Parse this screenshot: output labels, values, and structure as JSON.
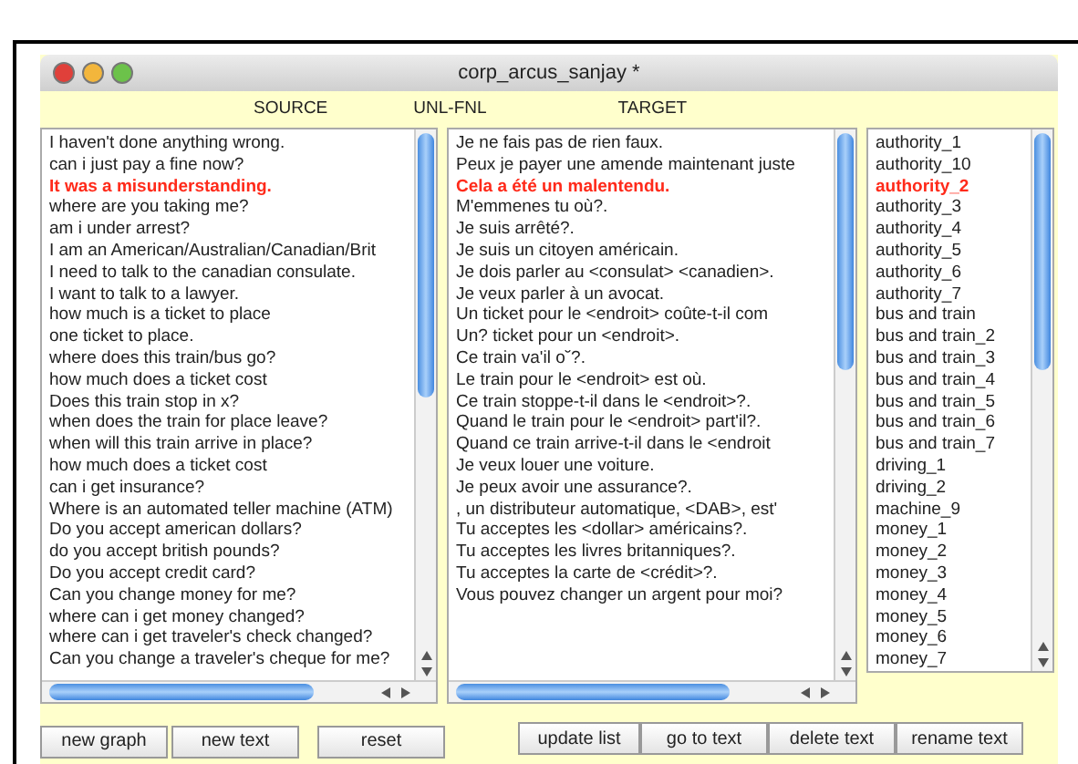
{
  "window": {
    "title": "corp_arcus_sanjay *"
  },
  "headers": [
    "SOURCE",
    "UNL-FNL",
    "TARGET"
  ],
  "source": [
    {
      "text": "I haven't done anything wrong.",
      "selected": false
    },
    {
      "text": "can i just pay a fine now?",
      "selected": false
    },
    {
      "text": "It was a misunderstanding.",
      "selected": true
    },
    {
      "text": "where are you taking me?",
      "selected": false
    },
    {
      "text": "am i under arrest?",
      "selected": false
    },
    {
      "text": "I am an American/Australian/Canadian/Brit",
      "selected": false
    },
    {
      "text": "I need to  talk to the canadian consulate.",
      "selected": false
    },
    {
      "text": "I want to talk to a lawyer.",
      "selected": false
    },
    {
      "text": "how much is a ticket to place",
      "selected": false
    },
    {
      "text": "one ticket to place.",
      "selected": false
    },
    {
      "text": "where does this train/bus go?",
      "selected": false
    },
    {
      "text": "how much does a ticket cost",
      "selected": false
    },
    {
      "text": "Does this train stop in x?",
      "selected": false
    },
    {
      "text": "when does the train for place leave?",
      "selected": false
    },
    {
      "text": "when will this train arrive in place?",
      "selected": false
    },
    {
      "text": "how much does a ticket cost",
      "selected": false
    },
    {
      "text": "can i get insurance?",
      "selected": false
    },
    {
      "text": "Where is an automated teller machine (ATM)",
      "selected": false
    },
    {
      "text": "Do you accept american dollars?",
      "selected": false
    },
    {
      "text": "do you accept british pounds?",
      "selected": false
    },
    {
      "text": "Do you accept credit card?",
      "selected": false
    },
    {
      "text": "Can you change money for me?",
      "selected": false
    },
    {
      "text": "where can i get money changed?",
      "selected": false
    },
    {
      "text": "where can i get traveler's check changed?",
      "selected": false
    },
    {
      "text": "Can you change a traveler's cheque for me?",
      "selected": false
    }
  ],
  "target": [
    {
      "text": "Je ne fais pas de rien faux.",
      "selected": false
    },
    {
      "text": "Peux je payer une amende maintenant juste",
      "selected": false
    },
    {
      "text": "Cela a été un malentendu.",
      "selected": true
    },
    {
      "text": "M'emmenes tu où?.",
      "selected": false
    },
    {
      "text": "Je suis arrêté?.",
      "selected": false
    },
    {
      "text": "Je suis un citoyen américain.",
      "selected": false
    },
    {
      "text": "Je dois parler au <consulat> <canadien>.",
      "selected": false
    },
    {
      "text": "Je veux parler à un avocat.",
      "selected": false
    },
    {
      "text": "Un ticket pour le <endroit> coûte-t-il com",
      "selected": false
    },
    {
      "text": "Un? ticket pour un <endroit>.",
      "selected": false
    },
    {
      "text": "Ce train va'il o˘?.",
      "selected": false
    },
    {
      "text": "Le train pour le <endroit> est où.",
      "selected": false
    },
    {
      "text": "Ce train stoppe-t-il dans le <endroit>?.",
      "selected": false
    },
    {
      "text": "Quand le train pour le <endroit> part'il?.",
      "selected": false
    },
    {
      "text": "Quand ce train arrive-t-il dans le <endroit",
      "selected": false
    },
    {
      "text": "Je veux louer une voiture.",
      "selected": false
    },
    {
      "text": "Je peux avoir une assurance?.",
      "selected": false
    },
    {
      "text": ", un distributeur automatique, <DAB>, est'",
      "selected": false
    },
    {
      "text": "Tu acceptes les <dollar> américains?.",
      "selected": false
    },
    {
      "text": "Tu acceptes les livres britanniques?.",
      "selected": false
    },
    {
      "text": "Tu acceptes la carte de <crédit>?.",
      "selected": false
    },
    {
      "text": "Vous pouvez changer un argent pour moi?",
      "selected": false
    }
  ],
  "texts": [
    {
      "text": "authority_1",
      "selected": false
    },
    {
      "text": "authority_10",
      "selected": false
    },
    {
      "text": "authority_2",
      "selected": true
    },
    {
      "text": "authority_3",
      "selected": false
    },
    {
      "text": "authority_4",
      "selected": false
    },
    {
      "text": "authority_5",
      "selected": false
    },
    {
      "text": "authority_6",
      "selected": false
    },
    {
      "text": "authority_7",
      "selected": false
    },
    {
      "text": "bus and train",
      "selected": false
    },
    {
      "text": "bus and train_2",
      "selected": false
    },
    {
      "text": "bus and train_3",
      "selected": false
    },
    {
      "text": "bus and train_4",
      "selected": false
    },
    {
      "text": "bus and train_5",
      "selected": false
    },
    {
      "text": "bus and train_6",
      "selected": false
    },
    {
      "text": "bus and train_7",
      "selected": false
    },
    {
      "text": "driving_1",
      "selected": false
    },
    {
      "text": "driving_2",
      "selected": false
    },
    {
      "text": "machine_9",
      "selected": false
    },
    {
      "text": "money_1",
      "selected": false
    },
    {
      "text": "money_2",
      "selected": false
    },
    {
      "text": "money_3",
      "selected": false
    },
    {
      "text": "money_4",
      "selected": false
    },
    {
      "text": "money_5",
      "selected": false
    },
    {
      "text": "money_6",
      "selected": false
    },
    {
      "text": "money_7",
      "selected": false
    }
  ],
  "left_buttons": [
    "new graph",
    "new text",
    "reset"
  ],
  "right_buttons": [
    "update list",
    "go to text",
    "delete text",
    "rename text"
  ]
}
